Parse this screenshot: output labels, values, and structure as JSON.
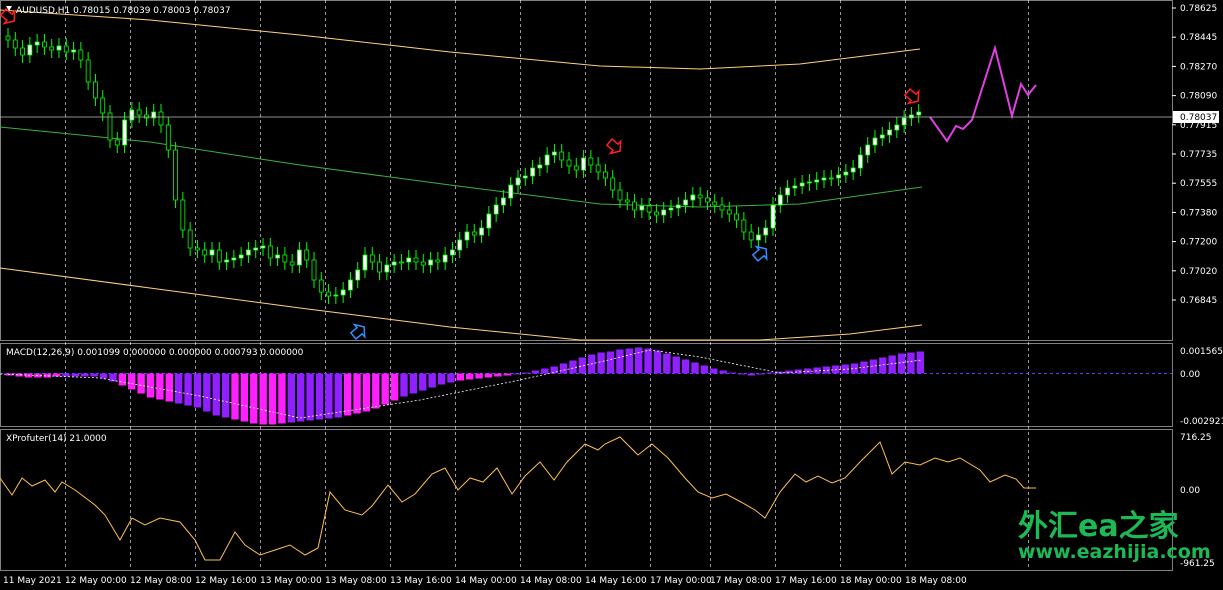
{
  "header": {
    "symbol_info": "AUDUSD,H1  0.78015 0.78039 0.78003 0.78037"
  },
  "macd": {
    "label": "MACD(12,26,9) 0.001099 0.000000 0.000000 0.000793 0.000000",
    "axis": {
      "top": "0.001565",
      "zero": "0.00",
      "bottom": "-0.002921"
    }
  },
  "xprofuter": {
    "label": "XProfuter(14) 21.0000",
    "axis": {
      "top": "716.25",
      "zero": "0.00",
      "bottom": "-961.25"
    }
  },
  "price_axis": {
    "labels": [
      "0.78625",
      "0.78445",
      "0.78270",
      "0.78090",
      "0.77915",
      "0.77735",
      "0.77555",
      "0.77380",
      "0.77200",
      "0.77020",
      "0.76845"
    ],
    "current_price": "0.78037"
  },
  "time_axis": {
    "labels": [
      "11 May 2021",
      "12 May 00:00",
      "12 May 08:00",
      "12 May 16:00",
      "13 May 00:00",
      "13 May 08:00",
      "13 May 16:00",
      "14 May 00:00",
      "14 May 08:00",
      "14 May 16:00",
      "17 May 00:00",
      "17 May 08:00",
      "17 May 16:00",
      "18 May 00:00",
      "18 May 08:00"
    ]
  },
  "watermark": {
    "line1": "外汇ea之家",
    "line2": "www.eazhijia.com"
  },
  "colors": {
    "background": "#000000",
    "bull_candle": "#ffffff",
    "bear_candle": "#000000",
    "wick": "#00ff00",
    "grid": "#ffffff",
    "envelope": "#ffd27f",
    "mid_ma": "#3cb043",
    "forecast": "#e040e0",
    "macd_pos": "#9020ff",
    "macd_neg": "#ff20ff",
    "oscillator": "#ffc04d",
    "sell_arrow": "#ff2020",
    "buy_arrow": "#3090ff",
    "watermark": "#1db954"
  },
  "icons": {
    "sell_signal": "sell-arrow-icon",
    "buy_signal": "buy-arrow-icon",
    "menu": "triangle-down-icon"
  }
}
